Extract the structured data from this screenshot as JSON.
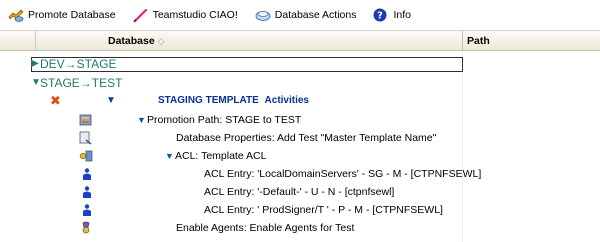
{
  "toolbar": {
    "promote": "Promote Database",
    "ciao": "Teamstudio CIAO!",
    "actions": "Database Actions",
    "info": "Info"
  },
  "header": {
    "database": "Database",
    "path": "Path"
  },
  "rows": {
    "cat1": "DEV→STAGE",
    "cat2": "STAGE→TEST",
    "staging_title": "STAGING TEMPLATE",
    "staging_sub": "Activities",
    "promotion_path": "Promotion Path: STAGE to TEST",
    "db_props": "Database Properties: Add Test \"Master Template Name\"",
    "acl": "ACL: Template ACL",
    "acl1": "ACL Entry: 'LocalDomainServers' - SG - M - [CTPNFSEWL]",
    "acl2": "ACL Entry: '-Default-' - U - N - [ctpnfsewl]",
    "acl3": "ACL Entry: ' ProdSigner/T  ' - P - M - [CTPNFSEWL]",
    "agents": "Enable Agents: Enable Agents for Test"
  },
  "colors": {
    "category": "#1f7a72",
    "staging": "#0b2f92",
    "delete": "#e24a12"
  }
}
